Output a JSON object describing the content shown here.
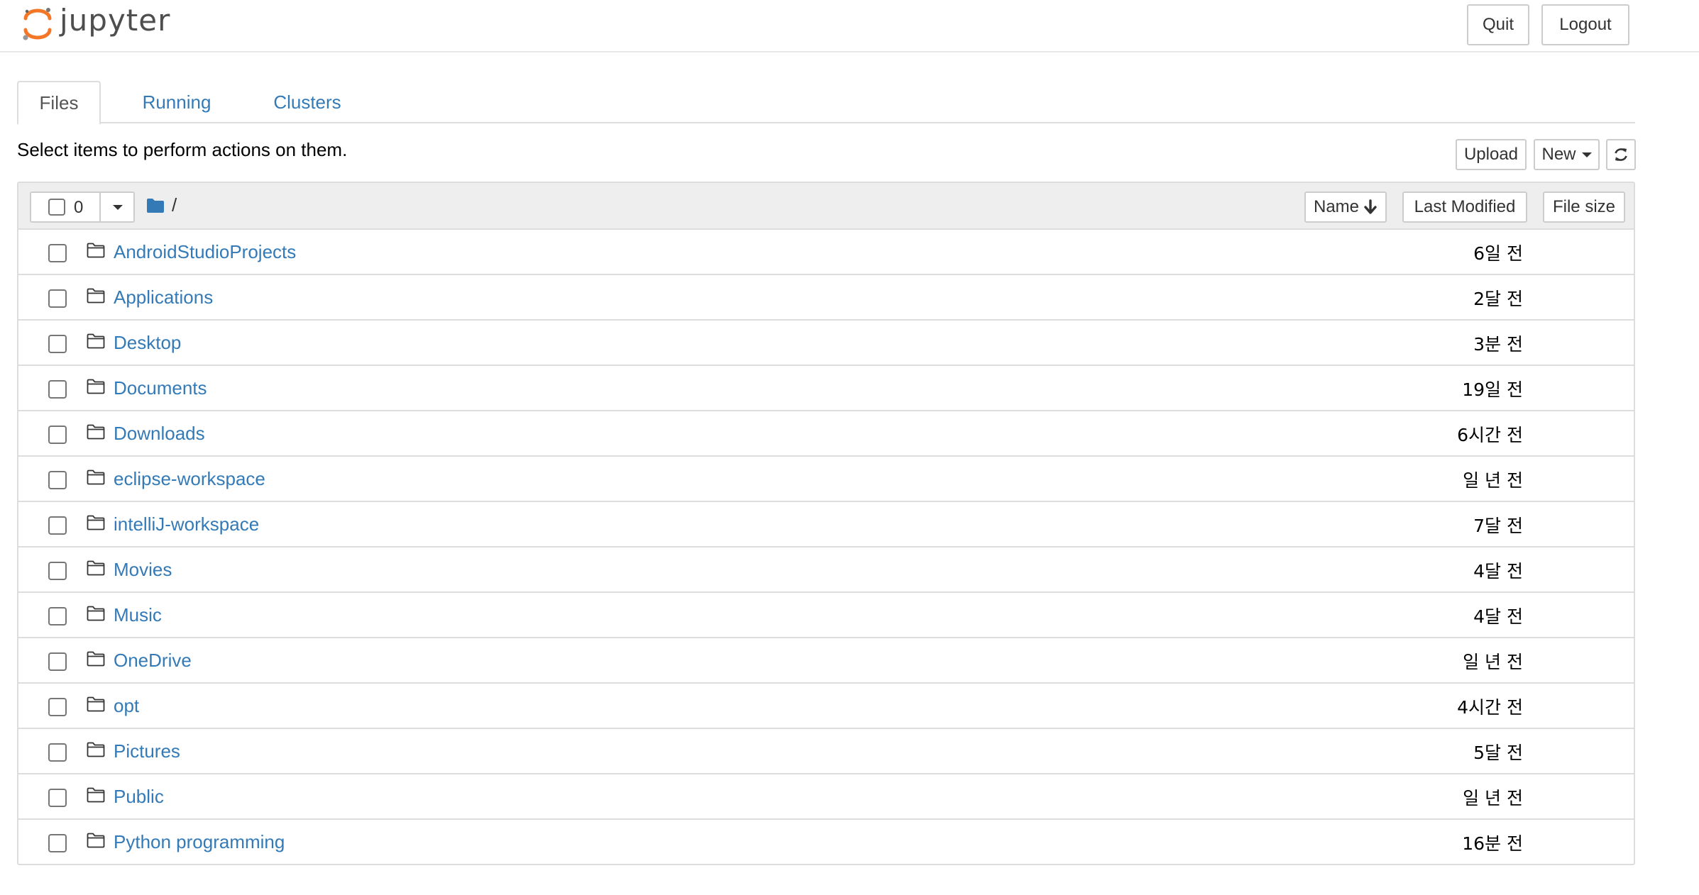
{
  "brand": {
    "name": "jupyter",
    "logo_icon": "jupyter-logo-icon"
  },
  "header": {
    "quit_label": "Quit",
    "logout_label": "Logout"
  },
  "tabs": [
    {
      "label": "Files",
      "active": true
    },
    {
      "label": "Running",
      "active": false
    },
    {
      "label": "Clusters",
      "active": false
    }
  ],
  "toolbar": {
    "instructions": "Select items to perform actions on them.",
    "upload_label": "Upload",
    "new_label": "New",
    "refresh_icon": "refresh-icon"
  },
  "list": {
    "selected_count": "0",
    "breadcrumb_icon": "folder-icon",
    "breadcrumb_sep": "/",
    "sort_name_label": "Name",
    "sort_modified_label": "Last Modified",
    "sort_size_label": "File size",
    "items": [
      {
        "name": "AndroidStudioProjects",
        "modified": "6일 전"
      },
      {
        "name": "Applications",
        "modified": "2달 전"
      },
      {
        "name": "Desktop",
        "modified": "3분 전"
      },
      {
        "name": "Documents",
        "modified": "19일 전"
      },
      {
        "name": "Downloads",
        "modified": "6시간 전"
      },
      {
        "name": "eclipse-workspace",
        "modified": "일 년 전"
      },
      {
        "name": "intelliJ-workspace",
        "modified": "7달 전"
      },
      {
        "name": "Movies",
        "modified": "4달 전"
      },
      {
        "name": "Music",
        "modified": "4달 전"
      },
      {
        "name": "OneDrive",
        "modified": "일 년 전"
      },
      {
        "name": "opt",
        "modified": "4시간 전"
      },
      {
        "name": "Pictures",
        "modified": "5달 전"
      },
      {
        "name": "Public",
        "modified": "일 년 전"
      },
      {
        "name": "Python programming",
        "modified": "16분 전"
      }
    ]
  },
  "colors": {
    "link": "#337ab7",
    "logo_orange": "#f37726",
    "border": "#dddddd",
    "header_bg": "#eeeeee"
  }
}
